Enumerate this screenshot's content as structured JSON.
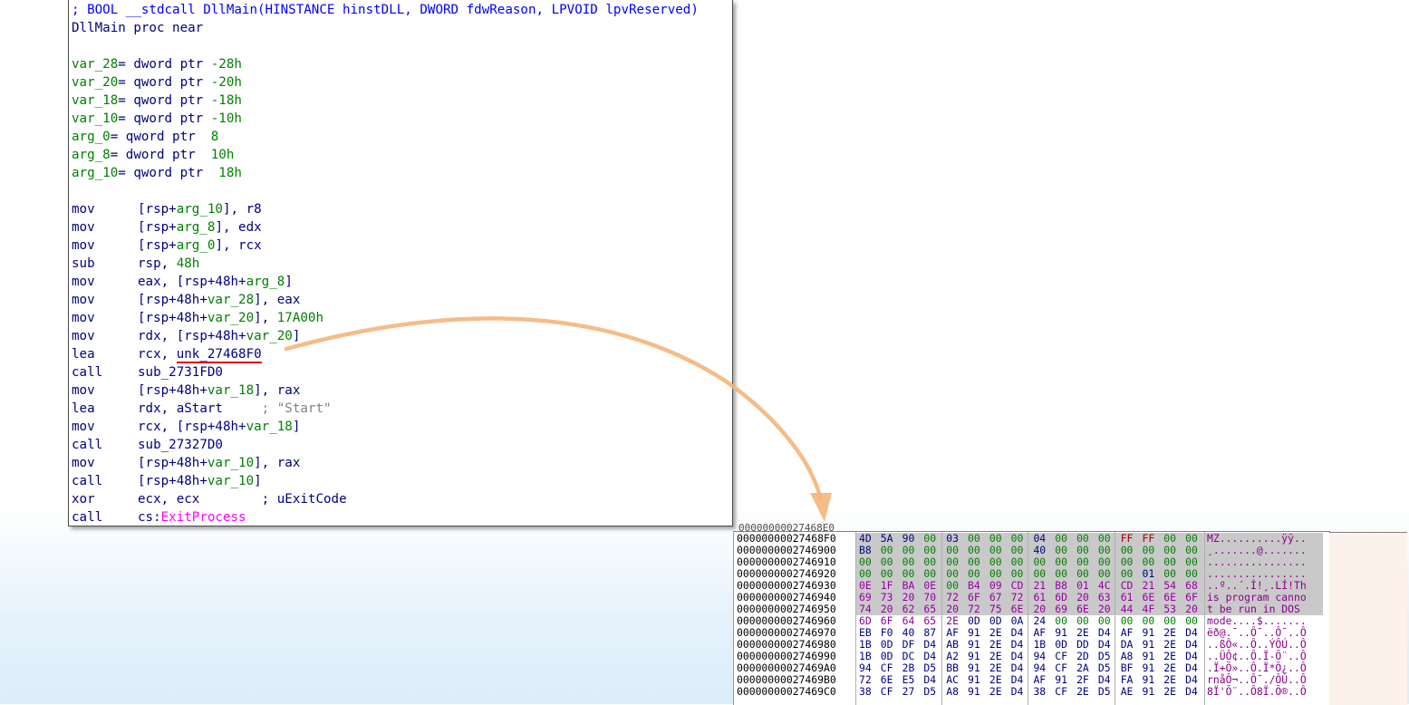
{
  "disasm": {
    "lines": [
      {
        "kind": "hdr",
        "text": "; BOOL __stdcall DllMain(HINSTANCE hinstDLL, DWORD fdwReason, LPVOID lpvReserved)"
      },
      {
        "kind": "plain",
        "text": "DllMain proc near"
      },
      {
        "kind": "blank",
        "text": ""
      },
      {
        "kind": "var",
        "name": "var_28",
        "rest": "= dword ptr ",
        "num": "-28h"
      },
      {
        "kind": "var",
        "name": "var_20",
        "rest": "= qword ptr ",
        "num": "-20h"
      },
      {
        "kind": "var",
        "name": "var_18",
        "rest": "= qword ptr ",
        "num": "-18h"
      },
      {
        "kind": "var",
        "name": "var_10",
        "rest": "= qword ptr ",
        "num": "-10h"
      },
      {
        "kind": "var",
        "name": "arg_0",
        "rest": "= qword ptr  ",
        "num": "8"
      },
      {
        "kind": "var",
        "name": "arg_8",
        "rest": "= dword ptr  ",
        "num": "10h"
      },
      {
        "kind": "var",
        "name": "arg_10",
        "rest": "= qword ptr  ",
        "num": "18h"
      },
      {
        "kind": "blank",
        "text": ""
      },
      {
        "kind": "ins",
        "mn": "mov",
        "parts": [
          [
            "p",
            "[rsp+"
          ],
          [
            "v",
            "arg_10"
          ],
          [
            "p",
            "], r8"
          ]
        ]
      },
      {
        "kind": "ins",
        "mn": "mov",
        "parts": [
          [
            "p",
            "[rsp+"
          ],
          [
            "v",
            "arg_8"
          ],
          [
            "p",
            "], edx"
          ]
        ]
      },
      {
        "kind": "ins",
        "mn": "mov",
        "parts": [
          [
            "p",
            "[rsp+"
          ],
          [
            "v",
            "arg_0"
          ],
          [
            "p",
            "], rcx"
          ]
        ]
      },
      {
        "kind": "ins",
        "mn": "sub",
        "parts": [
          [
            "p",
            "rsp, "
          ],
          [
            "n",
            "48h"
          ]
        ]
      },
      {
        "kind": "ins",
        "mn": "mov",
        "parts": [
          [
            "p",
            "eax, [rsp+48h+"
          ],
          [
            "v",
            "arg_8"
          ],
          [
            "p",
            "]"
          ]
        ]
      },
      {
        "kind": "ins",
        "mn": "mov",
        "parts": [
          [
            "p",
            "[rsp+48h+"
          ],
          [
            "v",
            "var_28"
          ],
          [
            "p",
            "], eax"
          ]
        ]
      },
      {
        "kind": "ins",
        "mn": "mov",
        "parts": [
          [
            "p",
            "[rsp+48h+"
          ],
          [
            "v",
            "var_20"
          ],
          [
            "p",
            "], "
          ],
          [
            "n",
            "17A00h"
          ]
        ]
      },
      {
        "kind": "ins",
        "mn": "mov",
        "parts": [
          [
            "p",
            "rdx, [rsp+48h+"
          ],
          [
            "v",
            "var_20"
          ],
          [
            "p",
            "]"
          ]
        ]
      },
      {
        "kind": "ins",
        "mn": "lea",
        "parts": [
          [
            "p",
            "rcx, "
          ],
          [
            "u",
            "unk_27468F0"
          ]
        ]
      },
      {
        "kind": "ins",
        "mn": "call",
        "parts": [
          [
            "p",
            "sub_2731FD0"
          ]
        ]
      },
      {
        "kind": "ins",
        "mn": "mov",
        "parts": [
          [
            "p",
            "[rsp+48h+"
          ],
          [
            "v",
            "var_18"
          ],
          [
            "p",
            "], rax"
          ]
        ]
      },
      {
        "kind": "ins",
        "mn": "lea",
        "parts": [
          [
            "p",
            "rdx, aStart     "
          ],
          [
            "c",
            "; \"Start\""
          ]
        ]
      },
      {
        "kind": "ins",
        "mn": "mov",
        "parts": [
          [
            "p",
            "rcx, [rsp+48h+"
          ],
          [
            "v",
            "var_18"
          ],
          [
            "p",
            "]"
          ]
        ]
      },
      {
        "kind": "ins",
        "mn": "call",
        "parts": [
          [
            "p",
            "sub_27327D0"
          ]
        ]
      },
      {
        "kind": "ins",
        "mn": "mov",
        "parts": [
          [
            "p",
            "[rsp+48h+"
          ],
          [
            "v",
            "var_10"
          ],
          [
            "p",
            "], rax"
          ]
        ]
      },
      {
        "kind": "ins",
        "mn": "call",
        "parts": [
          [
            "p",
            "[rsp+48h+"
          ],
          [
            "v",
            "var_10"
          ],
          [
            "p",
            "]"
          ]
        ]
      },
      {
        "kind": "ins",
        "mn": "xor",
        "parts": [
          [
            "p",
            "ecx, ecx        ; uExitCode"
          ]
        ]
      },
      {
        "kind": "ins",
        "mn": "call",
        "parts": [
          [
            "p",
            "cs:"
          ],
          [
            "i",
            "ExitProcess"
          ]
        ]
      }
    ]
  },
  "hexview": {
    "stub_text": "00000000027468E0",
    "rows": [
      {
        "addr": "00000000027468F0",
        "bytes": [
          "4D",
          "5A",
          "90",
          "00",
          "03",
          "00",
          "00",
          "00",
          "04",
          "00",
          "00",
          "00",
          "FF",
          "FF",
          "00",
          "00"
        ],
        "ascii": "MZ..........ÿÿ.."
      },
      {
        "addr": "0000000002746900",
        "bytes": [
          "B8",
          "00",
          "00",
          "00",
          "00",
          "00",
          "00",
          "00",
          "40",
          "00",
          "00",
          "00",
          "00",
          "00",
          "00",
          "00"
        ],
        "ascii": "¸.......@......."
      },
      {
        "addr": "0000000002746910",
        "bytes": [
          "00",
          "00",
          "00",
          "00",
          "00",
          "00",
          "00",
          "00",
          "00",
          "00",
          "00",
          "00",
          "00",
          "00",
          "00",
          "00"
        ],
        "ascii": "................"
      },
      {
        "addr": "0000000002746920",
        "bytes": [
          "00",
          "00",
          "00",
          "00",
          "00",
          "00",
          "00",
          "00",
          "00",
          "00",
          "00",
          "00",
          "00",
          "01",
          "00",
          "00"
        ],
        "ascii": "................"
      },
      {
        "addr": "0000000002746930",
        "bytes": [
          "0E",
          "1F",
          "BA",
          "0E",
          "00",
          "B4",
          "09",
          "CD",
          "21",
          "B8",
          "01",
          "4C",
          "CD",
          "21",
          "54",
          "68"
        ],
        "ascii": "..º..´.Í!¸.LÍ!Th"
      },
      {
        "addr": "0000000002746940",
        "bytes": [
          "69",
          "73",
          "20",
          "70",
          "72",
          "6F",
          "67",
          "72",
          "61",
          "6D",
          "20",
          "63",
          "61",
          "6E",
          "6E",
          "6F"
        ],
        "ascii": "is program canno"
      },
      {
        "addr": "0000000002746950",
        "bytes": [
          "74",
          "20",
          "62",
          "65",
          "20",
          "72",
          "75",
          "6E",
          "20",
          "69",
          "6E",
          "20",
          "44",
          "4F",
          "53",
          "20"
        ],
        "ascii": "t be run in DOS "
      },
      {
        "addr": "0000000002746960",
        "bytes": [
          "6D",
          "6F",
          "64",
          "65",
          "2E",
          "0D",
          "0D",
          "0A",
          "24",
          "00",
          "00",
          "00",
          "00",
          "00",
          "00",
          "00"
        ],
        "ascii": "mode....$......."
      },
      {
        "addr": "0000000002746970",
        "bytes": [
          "EB",
          "F0",
          "40",
          "87",
          "AF",
          "91",
          "2E",
          "D4",
          "AF",
          "91",
          "2E",
          "D4",
          "AF",
          "91",
          "2E",
          "D4"
        ],
        "ascii": "ëð@.¯..Ô¯..Ô¯..Ô"
      },
      {
        "addr": "0000000002746980",
        "bytes": [
          "1B",
          "0D",
          "DF",
          "D4",
          "AB",
          "91",
          "2E",
          "D4",
          "1B",
          "0D",
          "DD",
          "D4",
          "DA",
          "91",
          "2E",
          "D4"
        ],
        "ascii": "..ßÔ«..Ô..ÝÔÚ..Ô"
      },
      {
        "addr": "0000000002746990",
        "bytes": [
          "1B",
          "0D",
          "DC",
          "D4",
          "A2",
          "91",
          "2E",
          "D4",
          "94",
          "CF",
          "2D",
          "D5",
          "A8",
          "91",
          "2E",
          "D4"
        ],
        "ascii": "..ÜÔ¢..Ô.Ï-Õ¨..Ô"
      },
      {
        "addr": "00000000027469A0",
        "bytes": [
          "94",
          "CF",
          "2B",
          "D5",
          "BB",
          "91",
          "2E",
          "D4",
          "94",
          "CF",
          "2A",
          "D5",
          "BF",
          "91",
          "2E",
          "D4"
        ],
        "ascii": ".Ï+Õ»..Ô.Ï*Õ¿..Ô"
      },
      {
        "addr": "00000000027469B0",
        "bytes": [
          "72",
          "6E",
          "E5",
          "D4",
          "AC",
          "91",
          "2E",
          "D4",
          "AF",
          "91",
          "2F",
          "D4",
          "FA",
          "91",
          "2E",
          "D4"
        ],
        "ascii": "rnåÔ¬..Ô¯./ÔÚ..Ô"
      },
      {
        "addr": "00000000027469C0",
        "bytes": [
          "38",
          "CF",
          "27",
          "D5",
          "A8",
          "91",
          "2E",
          "D4",
          "38",
          "CF",
          "2E",
          "D5",
          "AE",
          "91",
          "2E",
          "D4"
        ],
        "ascii": "8Ï'Õ¨..Ô8Ï.Õ®..Ô"
      }
    ]
  },
  "colors": {
    "arrow": "#f5b57a",
    "annotation_underline": "#e00000",
    "selection": "#c9c9c9"
  }
}
